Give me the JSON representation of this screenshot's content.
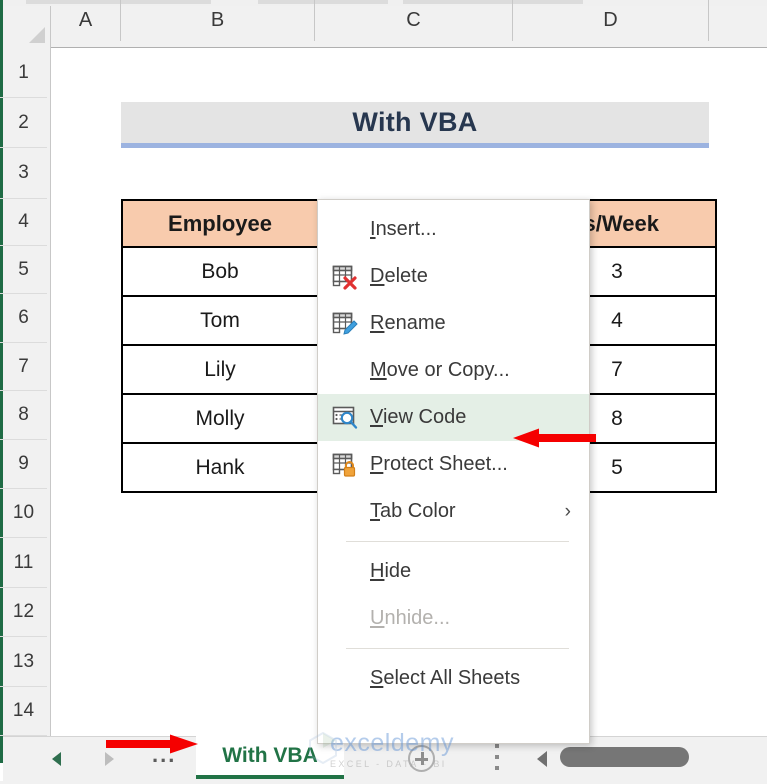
{
  "app": "Microsoft Excel",
  "grid": {
    "column_headers": [
      "A",
      "B",
      "C",
      "D"
    ],
    "row_headers": [
      "1",
      "2",
      "3",
      "4",
      "5",
      "6",
      "7",
      "8",
      "9",
      "10",
      "11",
      "12",
      "13",
      "14"
    ]
  },
  "title_banner": {
    "text": "With VBA",
    "fill_color": "#e4e4e4",
    "underline_color": "#9cb3e0",
    "text_color": "#27374f"
  },
  "table": {
    "header_fill": "#f8cbad",
    "headers": [
      "Employee",
      "",
      "rs/Week"
    ],
    "rows": [
      {
        "employee": "Bob",
        "middle": "",
        "hours": "3"
      },
      {
        "employee": "Tom",
        "middle": "",
        "hours": "4"
      },
      {
        "employee": "Lily",
        "middle": "",
        "hours": "7"
      },
      {
        "employee": "Molly",
        "middle": "",
        "hours": "8"
      },
      {
        "employee": "Hank",
        "middle": "",
        "hours": "5"
      }
    ]
  },
  "context_menu": {
    "highlight_color": "#e4efe6",
    "items": [
      {
        "label": "Insert...",
        "accel": "I",
        "icon": "none",
        "enabled": true,
        "highlighted": false,
        "submenu": false
      },
      {
        "label": "Delete",
        "accel": "D",
        "icon": "delete-sheet-icon",
        "enabled": true,
        "highlighted": false,
        "submenu": false
      },
      {
        "label": "Rename",
        "accel": "R",
        "icon": "rename-sheet-icon",
        "enabled": true,
        "highlighted": false,
        "submenu": false
      },
      {
        "label": "Move or Copy...",
        "accel": "M",
        "icon": "none",
        "enabled": true,
        "highlighted": false,
        "submenu": false
      },
      {
        "label": "View Code",
        "accel": "V",
        "icon": "view-code-icon",
        "enabled": true,
        "highlighted": true,
        "submenu": false
      },
      {
        "label": "Protect Sheet...",
        "accel": "P",
        "icon": "protect-sheet-icon",
        "enabled": true,
        "highlighted": false,
        "submenu": false
      },
      {
        "label": "Tab Color",
        "accel": "T",
        "icon": "none",
        "enabled": true,
        "highlighted": false,
        "submenu": true
      },
      {
        "label": "Hide",
        "accel": "H",
        "icon": "none",
        "enabled": true,
        "highlighted": false,
        "submenu": false
      },
      {
        "label": "Unhide...",
        "accel": "U",
        "icon": "none",
        "enabled": false,
        "highlighted": false,
        "submenu": false
      },
      {
        "label": "Select All Sheets",
        "accel": "S",
        "icon": "none",
        "enabled": true,
        "highlighted": false,
        "submenu": false
      }
    ],
    "submenu_chevron": "›"
  },
  "annotations": {
    "arrow_color": "#f50000",
    "arrow_to_view_code": "points at View Code menu item",
    "arrow_to_sheet_tab": "points at With VBA sheet tab"
  },
  "tab_bar": {
    "ellipsis": "...",
    "active_tab": "With VBA",
    "active_tab_color": "#217346",
    "add_sheet_label": "+"
  },
  "watermark": {
    "main": "exceldemy",
    "sub": "EXCEL - DATA - BI",
    "color": "#5b8fd4"
  }
}
